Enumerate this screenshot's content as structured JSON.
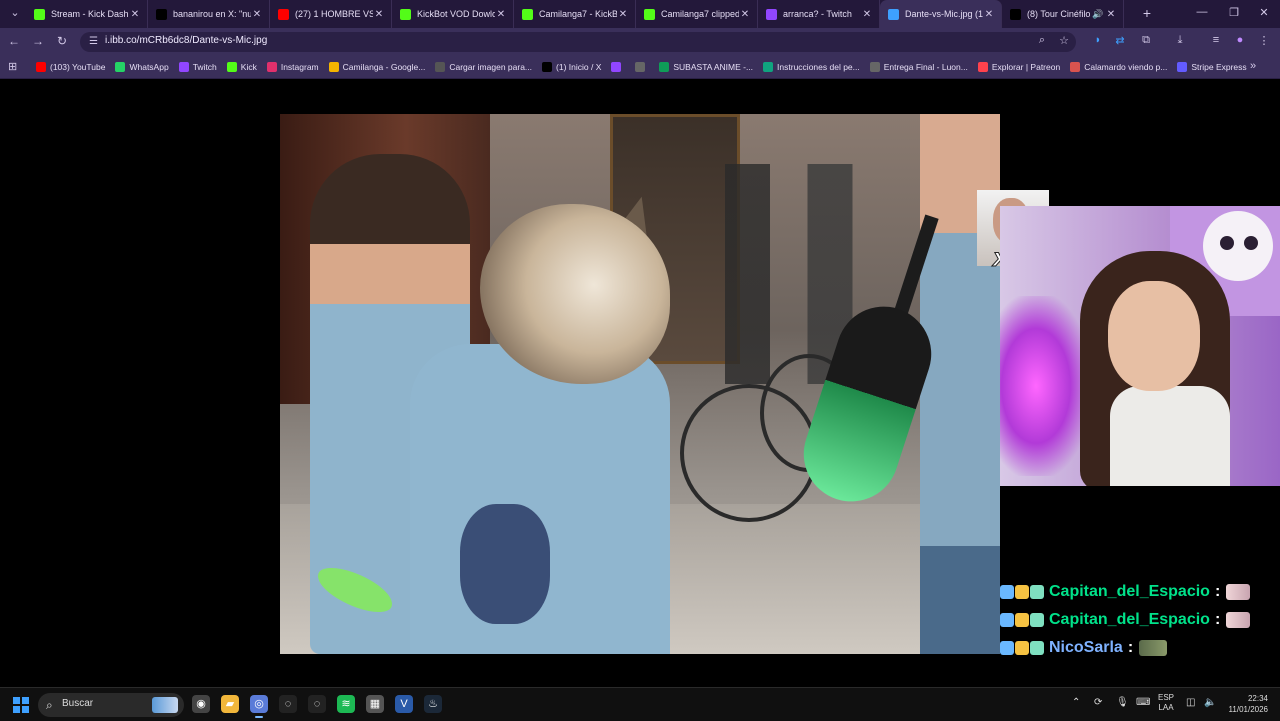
{
  "browser": {
    "tabs": [
      {
        "title": "Stream - Kick Dashbo",
        "icon": "kick-icon",
        "color": "#53fc18",
        "active": false
      },
      {
        "title": "bananirou en X: \"nun",
        "icon": "x-icon",
        "color": "#000000",
        "active": false
      },
      {
        "title": "(27) 1 HOMBRE VS 6",
        "icon": "youtube-icon",
        "color": "#ff0000",
        "active": false
      },
      {
        "title": "KickBot VOD Dowloa",
        "icon": "kickbot-icon",
        "color": "#53fc18",
        "active": false
      },
      {
        "title": "Camilanga7 - KickBot",
        "icon": "kickbot-icon",
        "color": "#53fc18",
        "active": false
      },
      {
        "title": "Camilanga7 clipped t",
        "icon": "kickbot-icon",
        "color": "#53fc18",
        "active": false
      },
      {
        "title": "arranca? - Twitch",
        "icon": "twitch-icon",
        "color": "#9146ff",
        "active": false
      },
      {
        "title": "Dante-vs-Mic.jpg (12",
        "icon": "image-icon",
        "color": "#3ea0ff",
        "active": true
      },
      {
        "title": "(8) Tour Cinéfilo",
        "icon": "x-icon",
        "color": "#000000",
        "active": false,
        "audio": true
      }
    ],
    "url": "i.ibb.co/mCRb6dc8/Dante-vs-Mic.jpg",
    "bookmarks": [
      {
        "label": "(103) YouTube",
        "icon": "youtube-icon",
        "color": "#ff0000"
      },
      {
        "label": "WhatsApp",
        "icon": "whatsapp-icon",
        "color": "#25d366"
      },
      {
        "label": "Twitch",
        "icon": "twitch-icon",
        "color": "#9146ff"
      },
      {
        "label": "Kick",
        "icon": "kick-icon",
        "color": "#53fc18"
      },
      {
        "label": "Instagram",
        "icon": "instagram-icon",
        "color": "#e1306c"
      },
      {
        "label": "Camilanga - Google...",
        "icon": "drive-icon",
        "color": "#f4b400"
      },
      {
        "label": "Cargar imagen para...",
        "icon": "imgbb-icon",
        "color": "#555555"
      },
      {
        "label": "(1) Inicio / X",
        "icon": "x-icon",
        "color": "#000000"
      },
      {
        "label": "",
        "icon": "twitch-icon",
        "color": "#9146ff"
      },
      {
        "label": "",
        "icon": "globe-icon",
        "color": "#666666"
      },
      {
        "label": "SUBASTA ANIME -...",
        "icon": "sheets-icon",
        "color": "#0f9d58"
      },
      {
        "label": "Instrucciones del pe...",
        "icon": "chatgpt-icon",
        "color": "#10a37f"
      },
      {
        "label": "Entrega Final - Luon...",
        "icon": "globe-icon",
        "color": "#666666"
      },
      {
        "label": "Explorar | Patreon",
        "icon": "patreon-icon",
        "color": "#ff424d"
      },
      {
        "label": "Calamardo viendo p...",
        "icon": "image-icon",
        "color": "#d9534f"
      },
      {
        "label": "Stripe Express",
        "icon": "stripe-icon",
        "color": "#635bff"
      }
    ]
  },
  "overlay": {
    "multiplier": "x2",
    "chat": [
      {
        "user": "Capitan_del_Espacio",
        "emote": "pink-emote"
      },
      {
        "user": "Capitan_del_Espacio",
        "emote": "pink-emote"
      },
      {
        "user": "NicoSarla",
        "emote": "car-emote"
      }
    ]
  },
  "taskbar": {
    "search_placeholder": "Buscar",
    "apps": [
      {
        "name": "recorder-icon",
        "color": "#444"
      },
      {
        "name": "file-explorer-icon",
        "color": "#f2b73b"
      },
      {
        "name": "chrome-icon",
        "color": "#5a7bd8",
        "active": true
      },
      {
        "name": "obs-icon",
        "color": "#222"
      },
      {
        "name": "obs2-icon",
        "color": "#222"
      },
      {
        "name": "spotify-icon",
        "color": "#1db954"
      },
      {
        "name": "discord-like-icon",
        "color": "#555"
      },
      {
        "name": "vscode-icon",
        "color": "#2a5aa8"
      },
      {
        "name": "steam-icon",
        "color": "#1b2838"
      }
    ],
    "lang_top": "ESP",
    "lang_bottom": "LAA",
    "time": "22:34",
    "date": "11/01/2026"
  }
}
